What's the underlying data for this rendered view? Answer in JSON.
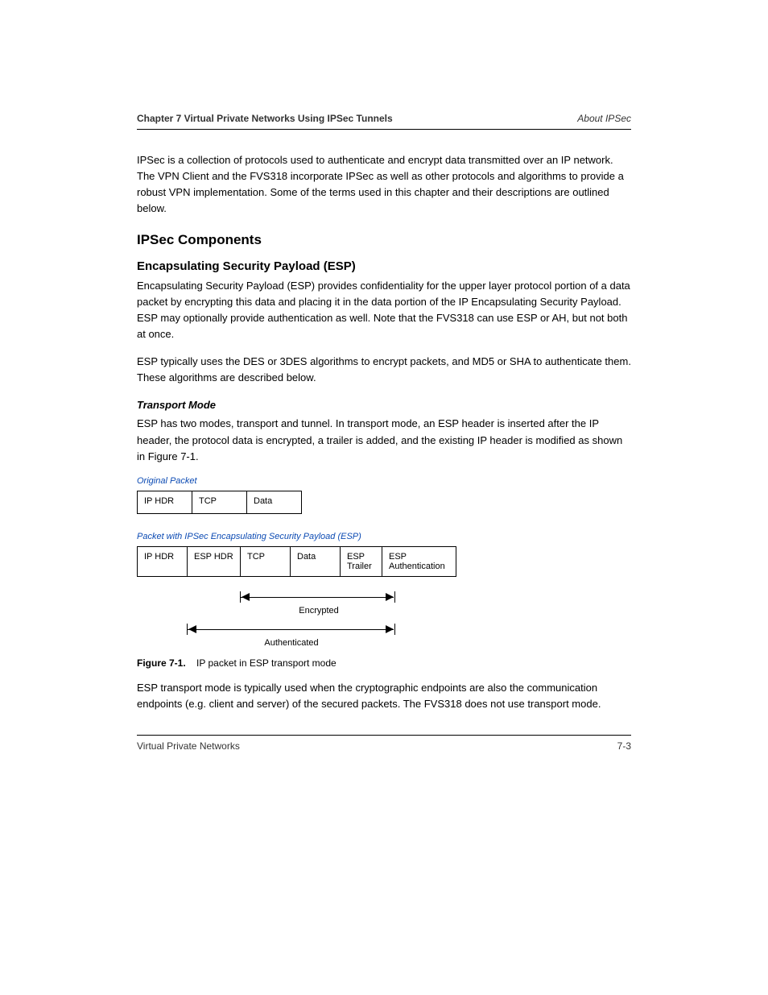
{
  "header": {
    "left": "Chapter 7 Virtual Private Networks Using IPSec Tunnels",
    "right": "About IPSec"
  },
  "para": {
    "p1": "IPSec is a collection of protocols used to authenticate and encrypt data transmitted over an IP network. The VPN Client and the FVS318 incorporate IPSec as well as other protocols and algorithms to provide a robust VPN implementation. Some of the terms used in this chapter and their descriptions are outlined below.",
    "p2": "Encapsulating Security Payload (ESP) provides confidentiality for the upper layer protocol portion of a data packet by encrypting this data and placing it in the data portion of the IP Encapsulating Security Payload. ESP may optionally provide authentication as well. Note that the FVS318 can use ESP or AH, but not both at once.",
    "p3": "ESP typically uses the DES or 3DES algorithms to encrypt packets, and MD5 or SHA to authenticate them. These algorithms are described below.",
    "p4": "ESP has two modes, transport and tunnel. In transport mode, an ESP header is inserted after the IP header, the protocol data is encrypted, a trailer is added, and the existing IP header is modified as shown in Figure 7-1.",
    "p5": "ESP transport mode is typically used when the cryptographic endpoints are also the communication endpoints (e.g. client and server) of the secured packets. The FVS318 does not use transport mode."
  },
  "headings": {
    "ipsec_components": "IPSec Components",
    "esp": "Encapsulating Security Payload (ESP)",
    "transport_mode": "Transport Mode"
  },
  "figure": {
    "label": "Figure 7-1.",
    "caption": "IP packet in ESP transport mode",
    "orig_label": "Original Packet",
    "esp_label": "Packet with IPSec Encapsulating Security Payload (ESP)",
    "orig_cells": [
      "IP HDR",
      "TCP",
      "Data"
    ],
    "esp_cells": [
      "IP HDR",
      "ESP HDR",
      "TCP",
      "Data",
      "ESP Trailer",
      "ESP Authentication"
    ],
    "encrypted_label": "Encrypted",
    "auth_label": "Authenticated"
  },
  "footer": {
    "left": "Virtual Private Networks",
    "right": "7-3"
  }
}
